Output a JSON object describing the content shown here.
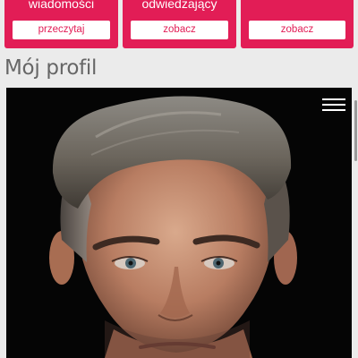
{
  "cards": [
    {
      "title": "wiadomości",
      "button_label": "przeczytaj"
    },
    {
      "title": "odwiedzający",
      "button_label": "zobacz"
    },
    {
      "title": "",
      "button_label": "zobacz"
    }
  ],
  "profile": {
    "section_title": "Mój profil",
    "photo_icon": "profile-photo",
    "menu_icon": "hamburger-menu-icon"
  },
  "colors": {
    "accent": "#e21d56",
    "background": "#ebebeb",
    "title_text": "#666666",
    "photo_background": "#050505"
  }
}
